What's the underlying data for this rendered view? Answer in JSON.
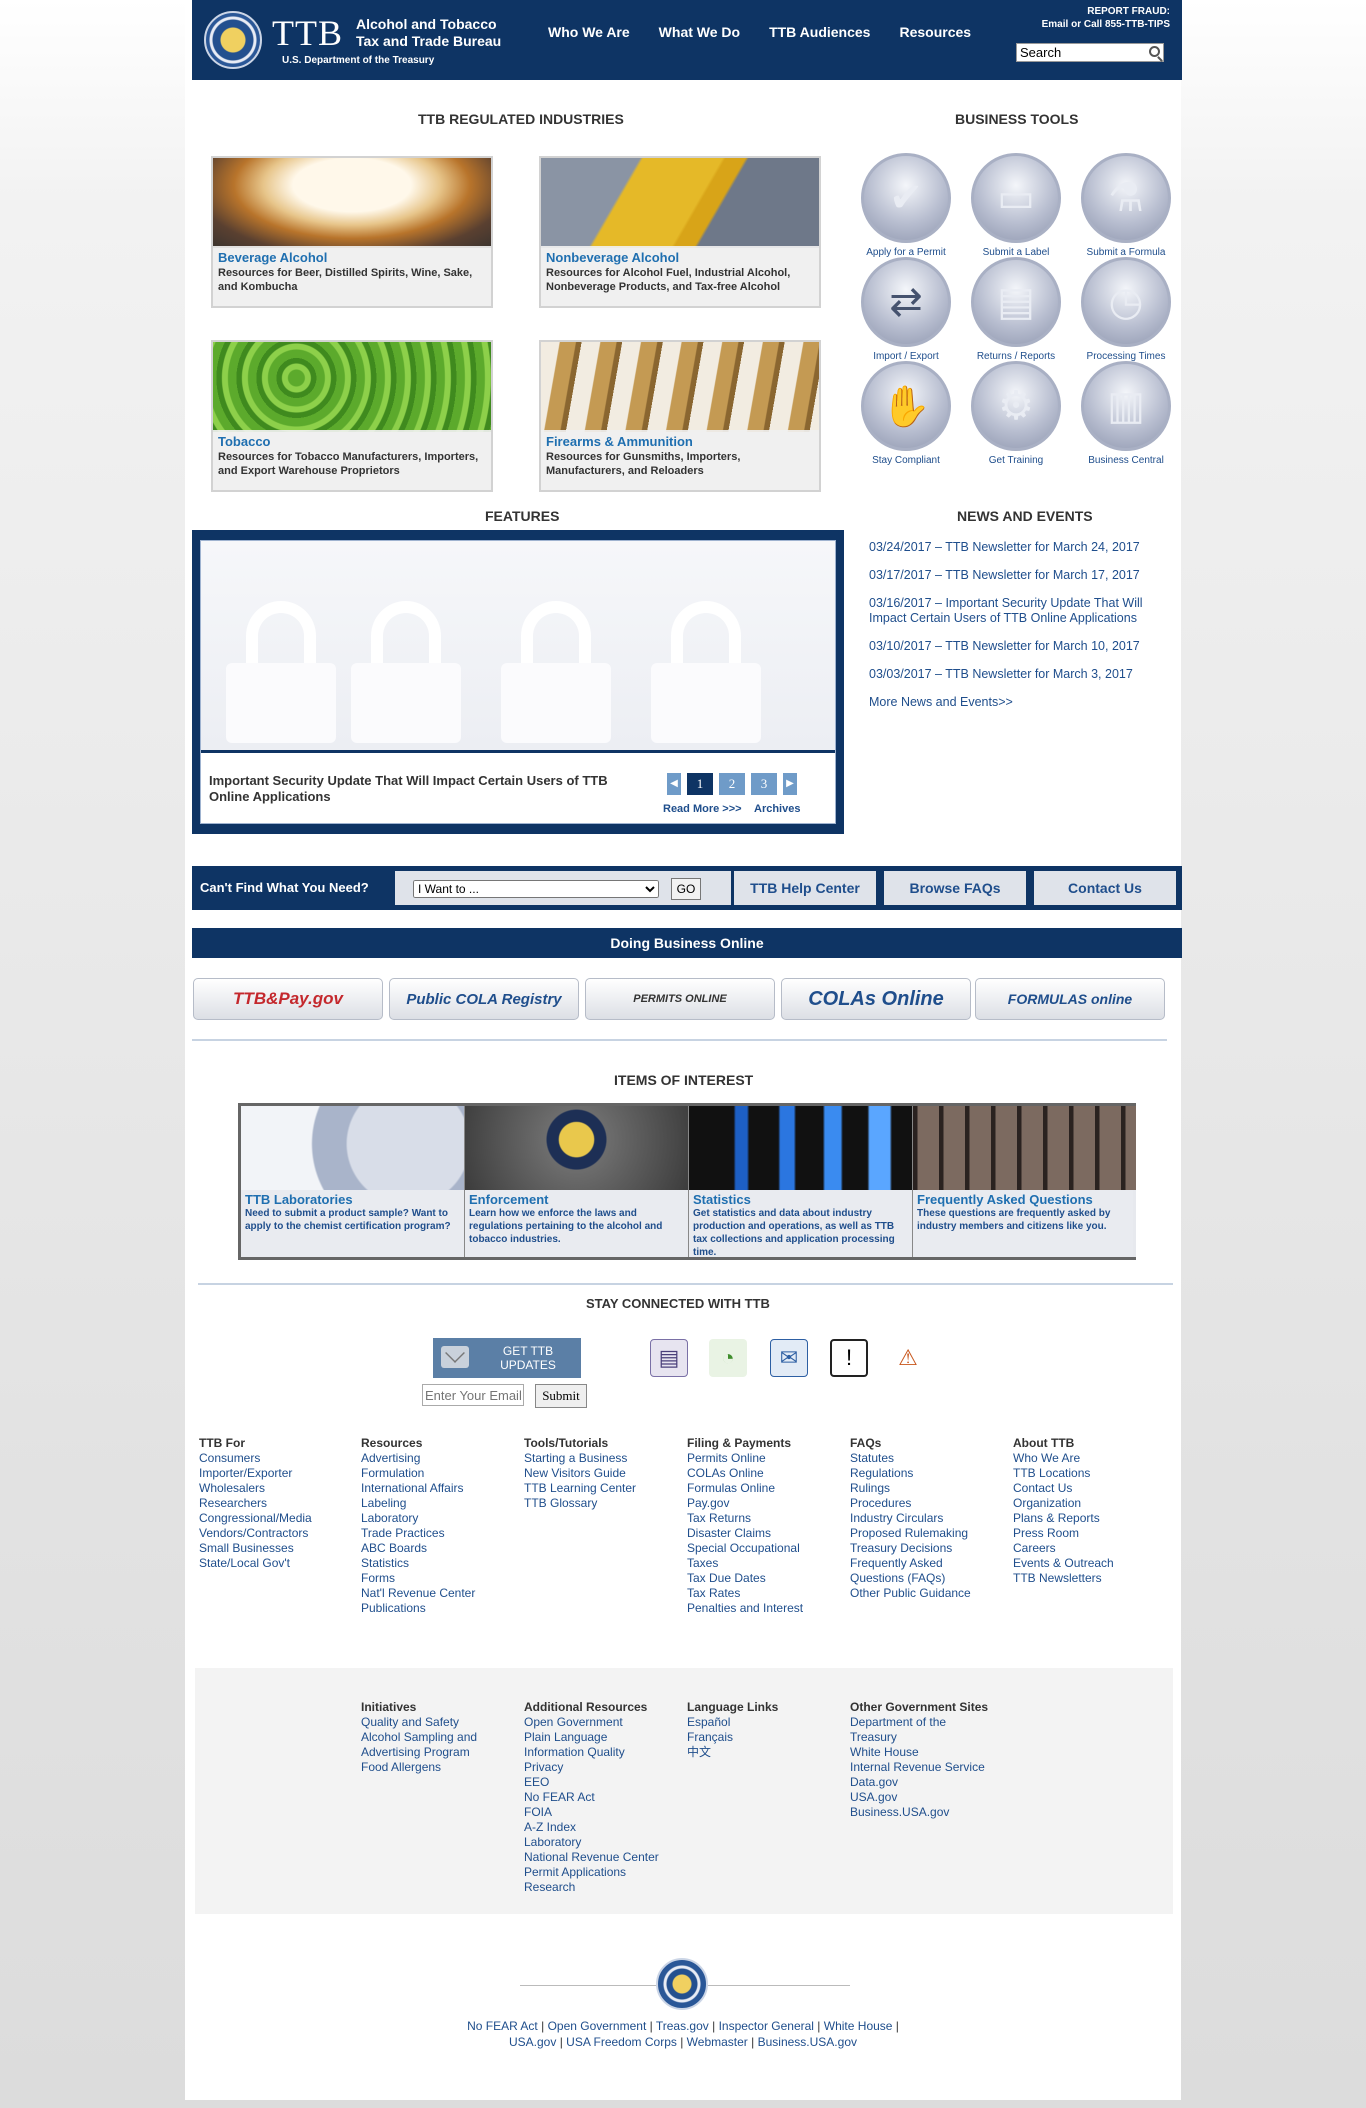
{
  "header": {
    "logo_text": "TTB",
    "agency_name": "Alcohol and Tobacco Tax and Trade Bureau",
    "department": "U.S. Department of the Treasury",
    "nav": [
      "Who We Are",
      "What We Do",
      "TTB Audiences",
      "Resources"
    ],
    "fraud_title": "REPORT FRAUD:",
    "fraud_text": "Email or Call 855-TTB-TIPS",
    "search_value": "Search"
  },
  "regulated": {
    "title": "TTB REGULATED INDUSTRIES",
    "tiles": [
      {
        "title": "Beverage Alcohol",
        "desc": "Resources for Beer, Distilled Spirits, Wine, Sake, and Kombucha"
      },
      {
        "title": "Nonbeverage Alcohol",
        "desc": "Resources for Alcohol Fuel, Industrial Alcohol, Nonbeverage Products, and Tax-free Alcohol"
      },
      {
        "title": "Tobacco",
        "desc": "Resources for Tobacco Manufacturers, Importers, and Export Warehouse Proprietors"
      },
      {
        "title": "Firearms & Ammunition",
        "desc": "Resources for Gunsmiths, Importers, Manufacturers, and Reloaders"
      }
    ]
  },
  "tools": {
    "title": "BUSINESS TOOLS",
    "items": [
      {
        "label": "Apply for a Permit",
        "icon": "checkmark-icon"
      },
      {
        "label": "Submit a Label",
        "icon": "apply-label-icon"
      },
      {
        "label": "Submit a Formula",
        "icon": "flask-icon"
      },
      {
        "label": "Import / Export",
        "icon": "arrows-icon"
      },
      {
        "label": "Returns / Reports",
        "icon": "document-icon"
      },
      {
        "label": "Processing Times",
        "icon": "clock-icon"
      },
      {
        "label": "Stay Compliant",
        "icon": "handshake-icon"
      },
      {
        "label": "Get Training",
        "icon": "gear-person-icon"
      },
      {
        "label": "Business Central",
        "icon": "bar-chart-icon"
      }
    ]
  },
  "features": {
    "title": "FEATURES",
    "headline": "Important Security Update That Will Impact Certain Users of TTB Online Applications",
    "pages": [
      "1",
      "2",
      "3"
    ],
    "read_more": "Read More >>>",
    "archives": "Archives"
  },
  "news": {
    "title": "NEWS AND EVENTS",
    "items": [
      "03/24/2017 – TTB Newsletter for March 24, 2017",
      "03/17/2017 – TTB Newsletter for March 17, 2017",
      "03/16/2017 – Important Security Update That Will Impact Certain Users of TTB Online Applications",
      "03/10/2017 – TTB Newsletter for March 10, 2017",
      "03/03/2017 – TTB Newsletter for March 3, 2017"
    ],
    "more": "More News and Events>>"
  },
  "findbar": {
    "label": "Can't Find What You Need?",
    "select_value": "I Want to ...",
    "go": "GO",
    "help": "TTB Help Center",
    "faqs": "Browse FAQs",
    "contact": "Contact Us"
  },
  "online": {
    "title": "Doing Business Online",
    "systems": [
      "TTB&Pay.gov",
      "Public COLA Registry",
      "PERMITS ONLINE",
      "COLAs Online",
      "FORMULAS online"
    ]
  },
  "interest": {
    "title": "ITEMS OF INTEREST",
    "items": [
      {
        "title": "TTB Laboratories",
        "desc": "Need to submit a product sample? Want to apply to the chemist certification program?"
      },
      {
        "title": "Enforcement",
        "desc": "Learn how we enforce the laws and regulations pertaining to the alcohol and tobacco industries."
      },
      {
        "title": "Statistics",
        "desc": "Get statistics and data about industry production and operations, as well as TTB tax collections and application processing time."
      },
      {
        "title": "Frequently Asked Questions",
        "desc": "These questions are frequently asked by industry members and citizens like you."
      }
    ]
  },
  "connect": {
    "title": "STAY CONNECTED WITH TTB",
    "updates": "GET TTB UPDATES",
    "email_placeholder": "Enter Your Email",
    "submit": "Submit"
  },
  "footer_cols": [
    {
      "h": "TTB For",
      "links": [
        "Consumers",
        "Importer/Exporter",
        "Wholesalers",
        "Researchers",
        "Congressional/Media",
        "Vendors/Contractors",
        "Small Businesses",
        "State/Local Gov't"
      ]
    },
    {
      "h": "Resources",
      "links": [
        "Advertising",
        "Formulation",
        "International Affairs",
        "Labeling",
        "Laboratory",
        "Trade Practices",
        "ABC Boards",
        "Statistics",
        "Forms",
        "Nat'l Revenue Center",
        "Publications"
      ]
    },
    {
      "h": "Tools/Tutorials",
      "links": [
        "Starting a Business",
        "New Visitors Guide",
        "TTB Learning Center",
        "TTB Glossary"
      ]
    },
    {
      "h": "Filing & Payments",
      "links": [
        "Permits Online",
        "COLAs Online",
        "Formulas Online",
        "Pay.gov",
        "Tax Returns",
        "Disaster Claims",
        "Special Occupational",
        "Taxes",
        "Tax Due Dates",
        "Tax Rates",
        "Penalties and Interest"
      ]
    },
    {
      "h": "FAQs",
      "links": [
        "Statutes",
        "Regulations",
        "Rulings",
        "Procedures",
        "Industry Circulars",
        "Proposed Rulemaking",
        "Treasury Decisions",
        "Frequently Asked",
        "Questions (FAQs)",
        "Other Public Guidance"
      ]
    },
    {
      "h": "About TTB",
      "links": [
        "Who We Are",
        "TTB Locations",
        "Contact Us",
        "Organization",
        "Plans & Reports",
        "Press Room",
        "Careers",
        "Events & Outreach",
        "TTB Newsletters"
      ]
    }
  ],
  "footer_cols2": [
    {
      "h": "Initiatives",
      "links": [
        "Quality and Safety",
        "Alcohol Sampling and",
        "Advertising Program",
        "Food Allergens"
      ]
    },
    {
      "h": "Additional Resources",
      "links": [
        "Open Government",
        "Plain Language",
        "Information Quality",
        "Privacy",
        "EEO",
        "No FEAR Act",
        "FOIA",
        "A-Z Index",
        "Laboratory",
        "National Revenue Center",
        "Permit Applications",
        "Research"
      ]
    },
    {
      "h": "Language Links",
      "links": [
        "Español",
        "Français",
        "中文"
      ]
    },
    {
      "h": "Other Government Sites",
      "links": [
        "Department of the",
        "Treasury",
        "White House",
        "Internal Revenue Service",
        "Data.gov",
        "USA.gov",
        "Business.USA.gov"
      ]
    }
  ],
  "bottom_links": {
    "row1": [
      "No FEAR Act",
      "Open Government",
      "Treas.gov",
      "Inspector General",
      "White House"
    ],
    "row2": [
      "USA.gov",
      "USA Freedom Corps",
      "Webmaster",
      "Business.USA.gov"
    ]
  }
}
